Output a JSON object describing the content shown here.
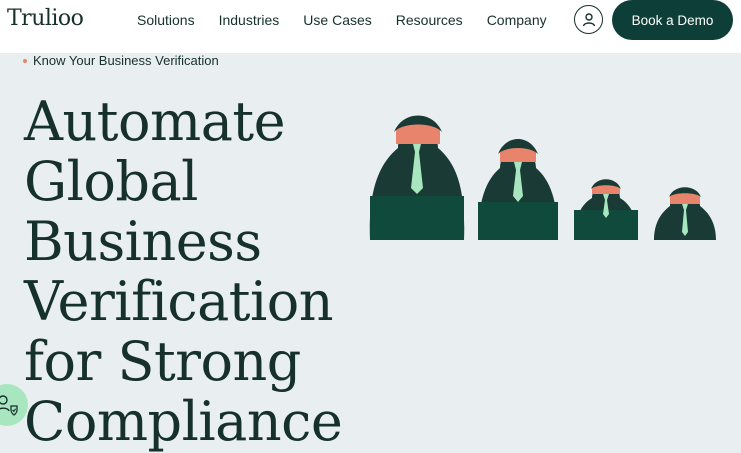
{
  "header": {
    "logo": "Trulioo",
    "nav": [
      "Solutions",
      "Industries",
      "Use Cases",
      "Resources",
      "Company"
    ],
    "demo_button": "Book a Demo"
  },
  "breadcrumb": "Know Your Business Verification",
  "hero": {
    "lines": [
      "Automate",
      "Global",
      "Business",
      "Verification",
      "for Strong",
      "Compliance"
    ]
  },
  "colors": {
    "accent": "#0d3f38",
    "coral": "#e8846c",
    "mint": "#a8e6bf",
    "background": "#e9eff0"
  },
  "icons": [
    "account-icon",
    "helper-badge-icon"
  ]
}
